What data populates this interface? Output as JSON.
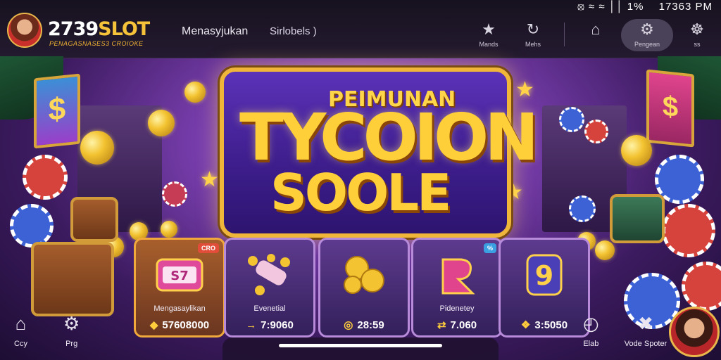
{
  "status_bar": {
    "icons": "⦻ ≈ ≈ ││",
    "battery": "1%",
    "time": "17363 PM"
  },
  "brand": {
    "name_part1": "2739",
    "name_part2": "SLOT",
    "tagline": "PENAGASNASES3 CROIOKE"
  },
  "nav": {
    "item1": "Menasyjukan",
    "item2": "Sirlobels )"
  },
  "toolbar": [
    {
      "icon": "star-icon",
      "glyph": "★",
      "label": "Mands"
    },
    {
      "icon": "refresh-icon",
      "glyph": "↻",
      "label": "Mehs"
    },
    {
      "icon": "cart-icon",
      "glyph": "⌂",
      "label": ""
    },
    {
      "icon": "gear-icon",
      "glyph": "⚙",
      "label": "Pengean"
    },
    {
      "icon": "settings-icon",
      "glyph": "☸",
      "label": "ss"
    }
  ],
  "banner": {
    "line1": "PEIMUNAN",
    "line2": "TYCOION",
    "line3": "SOOLE"
  },
  "cards": [
    {
      "badge": "CRO",
      "title": "Mengasaylikan",
      "price_icon": "◆",
      "price": "57608000",
      "art": "slot-machine-icon"
    },
    {
      "badge": "",
      "title": "Evenetial",
      "price_icon": "→",
      "price": "7:9060",
      "art": "cannon-icon"
    },
    {
      "badge": "",
      "title": "",
      "price_icon": "◎",
      "price": "28:59",
      "art": "coins-icon"
    },
    {
      "badge": "%",
      "title": "Pidenetey",
      "price_icon": "⇄",
      "price": "7.060",
      "art": "letter-r-icon"
    },
    {
      "badge": "",
      "title": "",
      "price_icon": "❖",
      "price": "3:5050",
      "art": "nine-emblem-icon"
    }
  ],
  "bottom_nav": {
    "left": [
      {
        "icon": "home-icon",
        "glyph": "⌂",
        "label": "Ccy"
      },
      {
        "icon": "settings-icon",
        "glyph": "⚙",
        "label": "Prg"
      }
    ],
    "right": [
      {
        "icon": "clock-icon",
        "glyph": "◴",
        "label": "Elab"
      },
      {
        "icon": "cross-icon",
        "glyph": "✖",
        "label": "Vode Spoter"
      }
    ]
  }
}
